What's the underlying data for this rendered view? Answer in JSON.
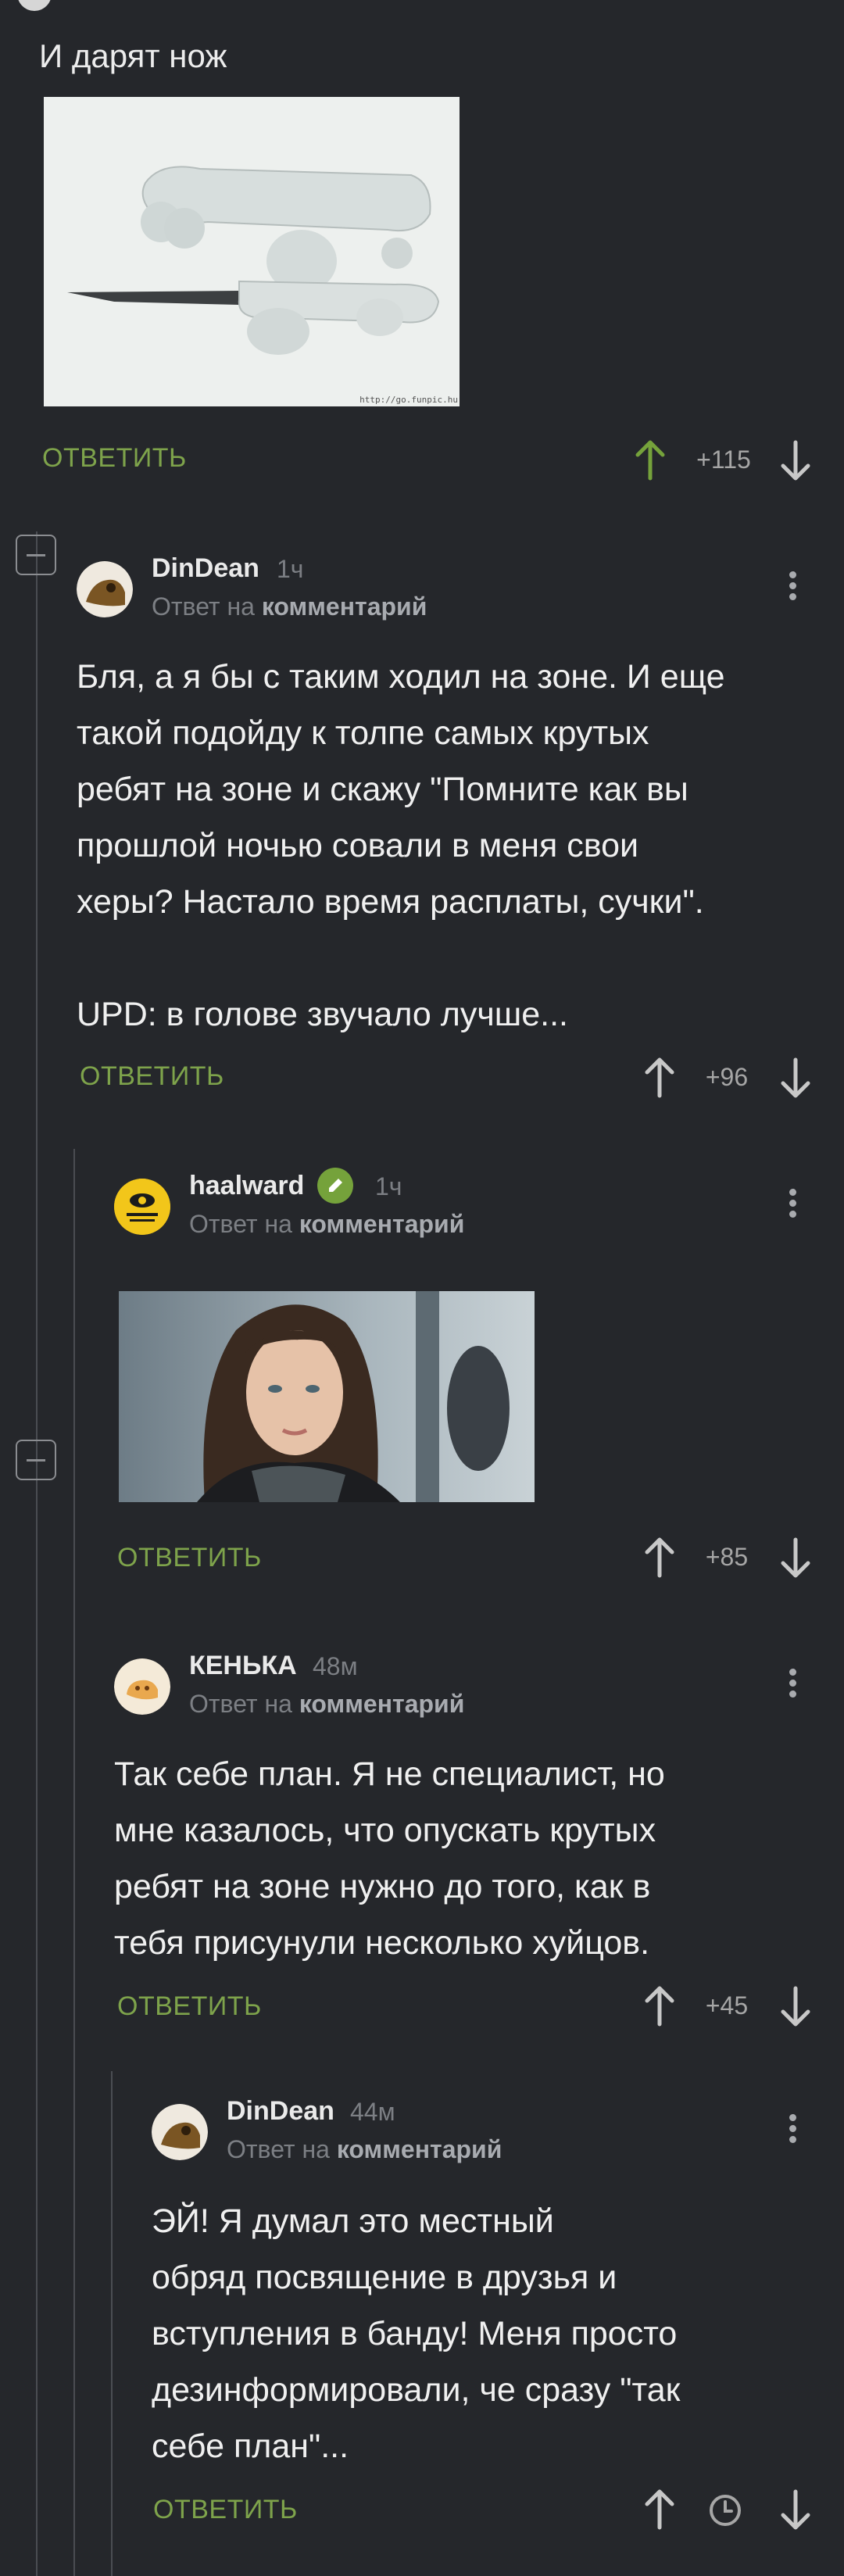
{
  "post": {
    "title": "И дарят нож",
    "image_watermark": "http://go.funpic.hu",
    "reply_label": "ОТВЕТИТЬ",
    "score": "+115"
  },
  "comments": [
    {
      "author": "DinDean",
      "time": "1ч",
      "reply_prefix": "Ответ на",
      "reply_target": "комментарий",
      "text_lines": [
        "Бля, а я бы с таким ходил на зоне. И еще",
        "такой подойду к толпе самых крутых",
        "ребят на зоне и скажу \"Помните как вы",
        "прошлой ночью совали в меня свои",
        "херы? Настало время расплаты, сучки\".",
        "",
        "UPD: в голове звучало лучше..."
      ],
      "reply_label": "ОТВЕТИТЬ",
      "score": "+96"
    },
    {
      "author": "haalward",
      "time": "1ч",
      "reply_prefix": "Ответ на",
      "reply_target": "комментарий",
      "reply_label": "ОТВЕТИТЬ",
      "score": "+85"
    },
    {
      "author": "КЕНЬКА",
      "time": "48м",
      "reply_prefix": "Ответ на",
      "reply_target": "комментарий",
      "text_lines": [
        "Так себе план. Я не специалист, но",
        "мне казалось, что опускать крутых",
        "ребят на зоне нужно до того, как в",
        "тебя присунули несколько хуйцов."
      ],
      "reply_label": "ОТВЕТИТЬ",
      "score": "+45"
    },
    {
      "author": "DinDean",
      "time": "44м",
      "reply_prefix": "Ответ на",
      "reply_target": "комментарий",
      "text_lines": [
        "ЭЙ! Я думал это местный",
        "обряд посвящение в друзья и",
        "вступления в банду! Меня просто",
        "дезинформировали, че сразу \"так",
        "себе план\"..."
      ],
      "reply_label": "ОТВЕТИТЬ"
    }
  ],
  "icons": {
    "upvote": "arrow-up-icon",
    "downvote": "arrow-down-icon",
    "more": "more-vertical-icon",
    "collapse": "collapse-thread-icon",
    "verified": "verified-pencil-icon",
    "clock": "clock-icon"
  },
  "colors": {
    "background": "#25272b",
    "accent_green": "#7ea34b",
    "upvoted_green": "#75a23b",
    "muted": "#7c7f84"
  }
}
